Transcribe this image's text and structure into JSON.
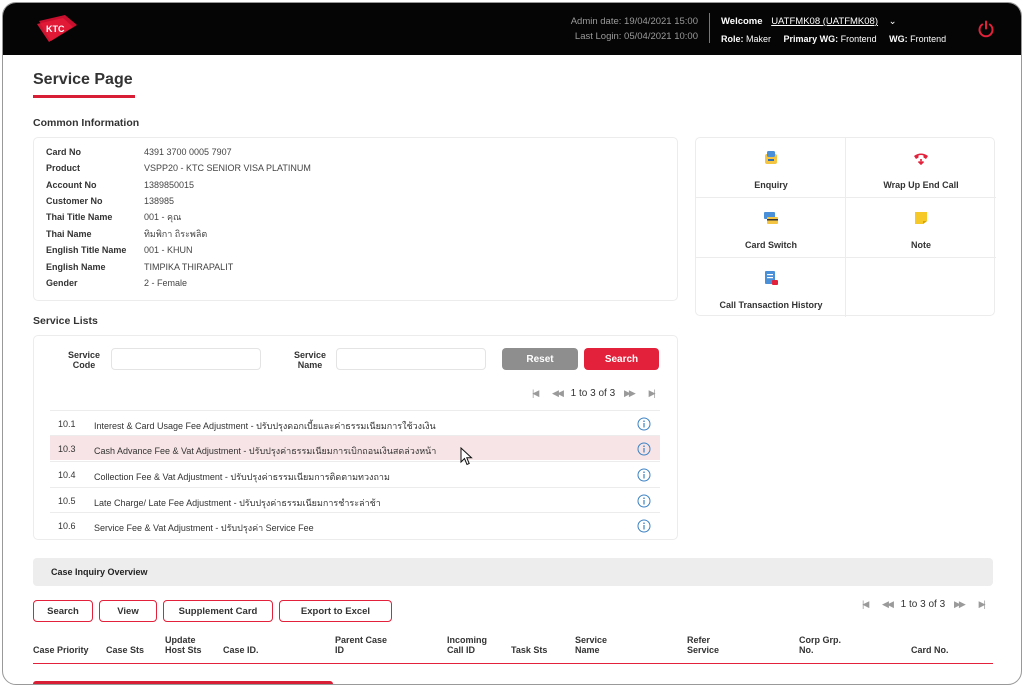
{
  "header": {
    "brand": "KTC",
    "admin_date": "Admin date: 19/04/2021 15:00",
    "last_login": "Last Login: 05/04/2021 10:00",
    "welcome_label": "Welcome",
    "welcome_user": "UATFMK08 (UATFMK08)",
    "role_label": "Role:",
    "role_value": "Maker",
    "primary_wg_label": "Primary WG:",
    "primary_wg_value": "Frontend",
    "wg_label": "WG:",
    "wg_value": "Frontend"
  },
  "page": {
    "title": "Service Page"
  },
  "common_info": {
    "heading": "Common Information",
    "fields": [
      {
        "label": "Card No",
        "value": "4391 3700 0005 7907"
      },
      {
        "label": "Product",
        "value": "VSPP20 - KTC SENIOR VISA PLATINUM"
      },
      {
        "label": "Account No",
        "value": "1389850015"
      },
      {
        "label": "Customer No",
        "value": "138985"
      },
      {
        "label": "Thai Title Name",
        "value": "001 - คุณ"
      },
      {
        "label": "Thai Name",
        "value": "ทิมพิกา ถิระพลิต"
      },
      {
        "label": "English Title Name",
        "value": "001 - KHUN"
      },
      {
        "label": "English Name",
        "value": "TIMPIKA THIRAPALIT"
      },
      {
        "label": "Gender",
        "value": "2 - Female"
      }
    ]
  },
  "quick_actions": [
    {
      "label": "Enquiry",
      "icon": "enquiry-icon"
    },
    {
      "label": "Wrap Up End Call",
      "icon": "phone-end-icon"
    },
    {
      "label": "Card Switch",
      "icon": "card-switch-icon"
    },
    {
      "label": "Note",
      "icon": "note-icon"
    },
    {
      "label": "Call Transaction History",
      "icon": "history-icon"
    }
  ],
  "service_lists": {
    "heading": "Service Lists",
    "code_label_1": "Service",
    "code_label_2": "Code",
    "name_label_1": "Service",
    "name_label_2": "Name",
    "reset_label": "Reset",
    "search_label": "Search",
    "pager_text": "1 to 3 of 3",
    "items": [
      {
        "code": "10.1",
        "name": "Interest & Card Usage Fee Adjustment - ปรับปรุงดอกเบี้ยและค่าธรรมเนียมการใช้วงเงิน"
      },
      {
        "code": "10.3",
        "name": "Cash Advance Fee & Vat Adjustment - ปรับปรุงค่าธรรมเนียมการเบิกถอนเงินสดล่วงหน้า"
      },
      {
        "code": "10.4",
        "name": "Collection Fee & Vat Adjustment - ปรับปรุงค่าธรรมเนียมการติดตามทวงถาม"
      },
      {
        "code": "10.5",
        "name": "Late Charge/ Late Fee Adjustment - ปรับปรุงค่าธรรมเนียมการชำระล่าช้า"
      },
      {
        "code": "10.6",
        "name": "Service Fee & Vat Adjustment - ปรับปรุงค่า Service Fee"
      }
    ]
  },
  "case_inquiry": {
    "heading": "Case Inquiry Overview",
    "buttons": {
      "search": "Search",
      "view": "View",
      "supplement": "Supplement Card",
      "export": "Export to Excel"
    },
    "pager_text": "1 to 3 of 3",
    "columns": [
      {
        "l1": "Case Priority",
        "l2": ""
      },
      {
        "l1": "Case Sts",
        "l2": ""
      },
      {
        "l1": "Update",
        "l2": "Host Sts"
      },
      {
        "l1": "Case ID.",
        "l2": ""
      },
      {
        "l1": "Parent Case",
        "l2": "ID"
      },
      {
        "l1": "Incoming",
        "l2": "Call ID"
      },
      {
        "l1": "Task Sts",
        "l2": ""
      },
      {
        "l1": "Service",
        "l2": "Name"
      },
      {
        "l1": "Refer",
        "l2": "Service"
      },
      {
        "l1": "Corp Grp.",
        "l2": "No."
      },
      {
        "l1": "Card No.",
        "l2": ""
      }
    ]
  },
  "colors": {
    "accent": "#e3213a",
    "header_bg": "#050505",
    "selected_row": "#f7e4e6"
  }
}
